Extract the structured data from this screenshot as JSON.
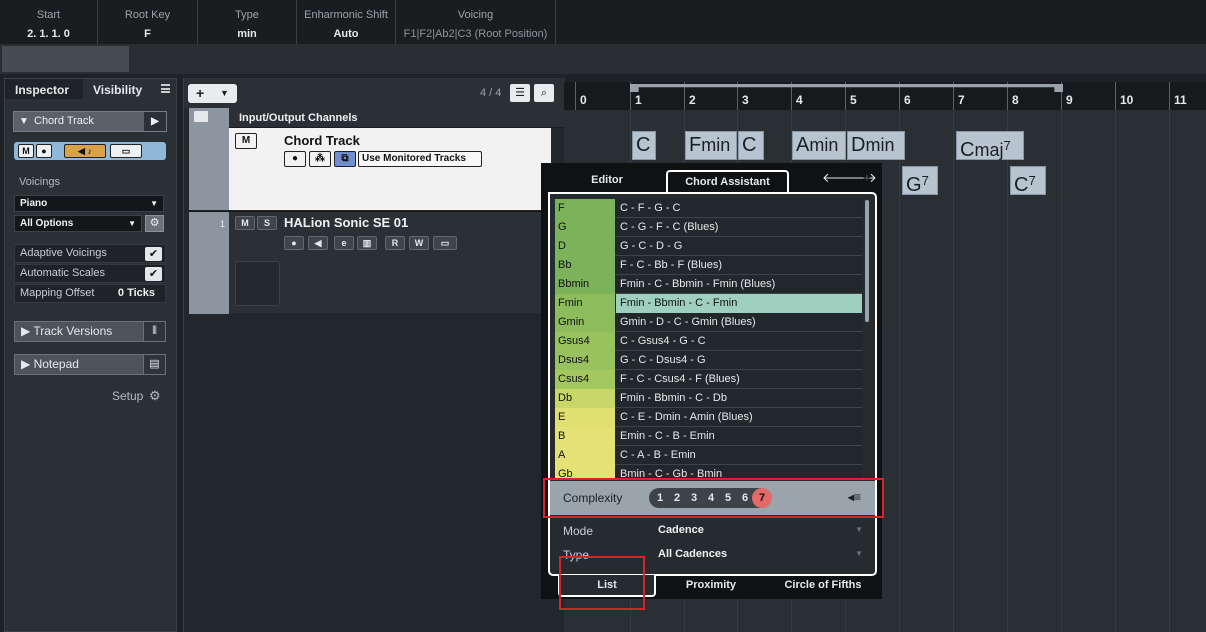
{
  "infoline": {
    "columns": [
      {
        "label": "Start",
        "value": "2. 1. 1.   0"
      },
      {
        "label": "Root Key",
        "value": "F"
      },
      {
        "label": "Type",
        "value": "min"
      },
      {
        "label": "Enharmonic Shift",
        "value": "Auto"
      },
      {
        "label": "Voicing",
        "value": "F1|F2|Ab2|C3 (Root Position)"
      }
    ]
  },
  "inspector": {
    "tabs": [
      "Inspector",
      "Visibility"
    ],
    "section_title": "Chord Track",
    "voicings_label": "Voicings",
    "voicing_value": "Piano",
    "options_value": "All Options",
    "adaptive_voicings": "Adaptive Voicings",
    "automatic_scales": "Automatic Scales",
    "mapping_offset": "Mapping Offset",
    "mapping_offset_value": "0 Ticks",
    "track_versions": "Track Versions",
    "notepad": "Notepad",
    "setup": "Setup"
  },
  "tracklist": {
    "count": "4 / 4",
    "io_channels": "Input/Output Channels",
    "chord_track": "Chord Track",
    "use_monitored": "Use Monitored Tracks",
    "instrument_num": "1",
    "instrument_name": "HALion Sonic SE 01"
  },
  "ruler": {
    "bars": [
      "0",
      "1",
      "2",
      "3",
      "4",
      "5",
      "6",
      "7",
      "8",
      "9",
      "10",
      "11"
    ]
  },
  "chord_events": [
    {
      "root": "C",
      "ext": "",
      "sup": ""
    },
    {
      "root": "F",
      "ext": "min",
      "sup": ""
    },
    {
      "root": "C",
      "ext": "",
      "sup": ""
    },
    {
      "root": "A",
      "ext": "min",
      "sup": ""
    },
    {
      "root": "D",
      "ext": "min",
      "sup": ""
    },
    {
      "root": "C",
      "ext": "maj",
      "sup": "7"
    },
    {
      "root": "G",
      "ext": "",
      "sup": "7"
    },
    {
      "root": "C",
      "ext": "",
      "sup": "7"
    }
  ],
  "assistant": {
    "tabs": [
      "Editor",
      "Chord Assistant"
    ],
    "rows": [
      {
        "key": "F",
        "prog": "C - F - G - C",
        "color": "#7cb25a"
      },
      {
        "key": "G",
        "prog": "C - G - F - C (Blues)",
        "color": "#7cb25a"
      },
      {
        "key": "D",
        "prog": "G - C - D - G",
        "color": "#7cb25a"
      },
      {
        "key": "Bb",
        "prog": "F - C - Bb - F (Blues)",
        "color": "#7cb25a"
      },
      {
        "key": "Bbmin",
        "prog": "Fmin - C - Bbmin - Fmin (Blues)",
        "color": "#7cb25a"
      },
      {
        "key": "Fmin",
        "prog": "Fmin - Bbmin - C - Fmin",
        "color": "#8cbc5c"
      },
      {
        "key": "Gmin",
        "prog": "Gmin - D - C - Gmin (Blues)",
        "color": "#8cbc5c"
      },
      {
        "key": "Gsus4",
        "prog": "C - Gsus4 - G - C",
        "color": "#98c25e"
      },
      {
        "key": "Dsus4",
        "prog": "G - C - Dsus4 - G",
        "color": "#98c25e"
      },
      {
        "key": "Csus4",
        "prog": "F - C - Csus4 - F (Blues)",
        "color": "#a4c860"
      },
      {
        "key": "Db",
        "prog": "Fmin - Bbmin - C - Db",
        "color": "#c8d868"
      },
      {
        "key": "E",
        "prog": "C - E - Dmin - Amin (Blues)",
        "color": "#dfe070"
      },
      {
        "key": "B",
        "prog": "Emin - C - B - Emin",
        "color": "#e4e274"
      },
      {
        "key": "A",
        "prog": "C - A - B - Emin",
        "color": "#e4e274"
      },
      {
        "key": "Gb",
        "prog": "Bmin - C - Gb - Bmin",
        "color": "#e4e274"
      }
    ],
    "selected_index": 5,
    "complexity_label": "Complexity",
    "complexity_levels": [
      "1",
      "2",
      "3",
      "4",
      "5",
      "6",
      "7"
    ],
    "complexity_selected": "7",
    "mode_label": "Mode",
    "mode_value": "Cadence",
    "type_label": "Type",
    "type_value": "All Cadences",
    "bottom_tabs": [
      "List",
      "Proximity",
      "Circle of Fifths"
    ]
  },
  "colors": {
    "highlight": "#d4242c",
    "selected_row": "#9fcfbf",
    "complexity_selected": "#e36a6a"
  }
}
